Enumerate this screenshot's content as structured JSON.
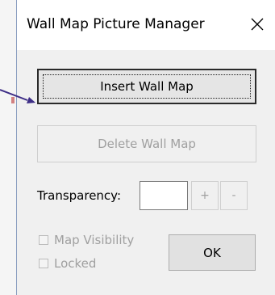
{
  "dialog": {
    "title": "Wall Map Picture Manager",
    "close_label": "✕"
  },
  "buttons": {
    "insert_label": "Insert Wall Map",
    "delete_label": "Delete Wall Map",
    "plus_label": "+",
    "minus_label": "-",
    "ok_label": "OK"
  },
  "transparency": {
    "label": "Transparency:",
    "value": ""
  },
  "checkboxes": {
    "visibility_label": "Map Visibility",
    "locked_label": "Locked"
  },
  "colors": {
    "arrow": "#3d2d86"
  }
}
